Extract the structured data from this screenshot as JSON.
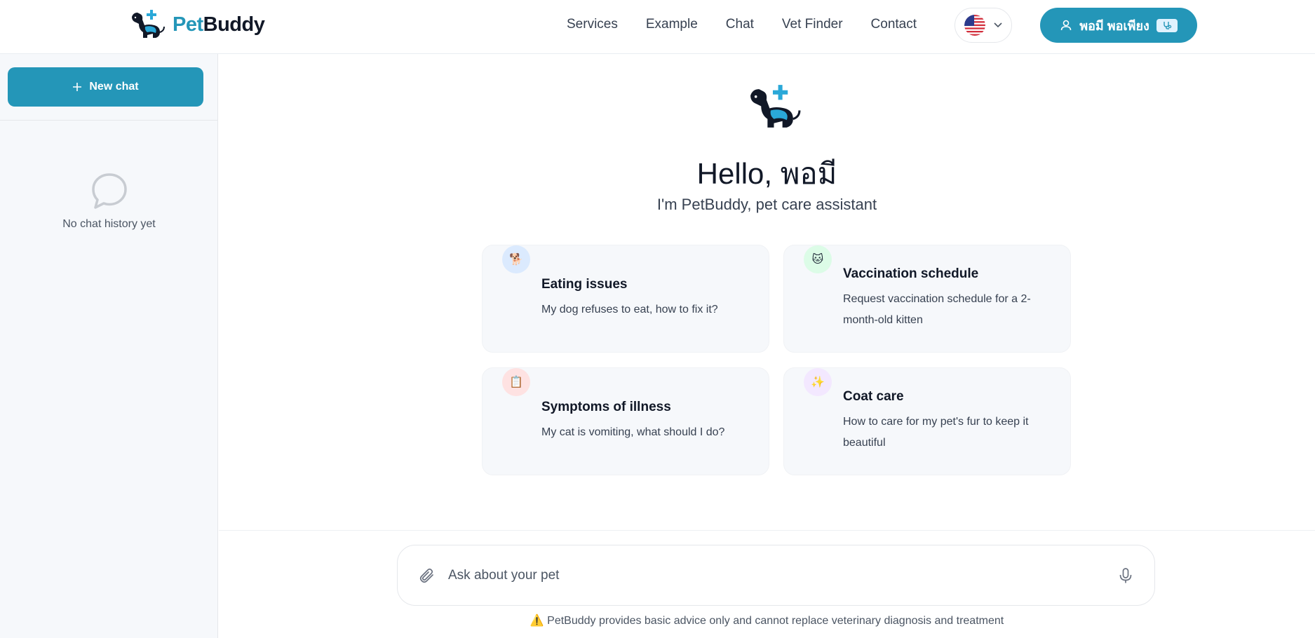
{
  "brand": {
    "name_part1": "Pet",
    "name_part2": "Buddy"
  },
  "nav": {
    "items": [
      "Services",
      "Example",
      "Chat",
      "Vet Finder",
      "Contact"
    ]
  },
  "language": {
    "icon": "us-flag-icon"
  },
  "user": {
    "name": "พอมี พอเพียง"
  },
  "sidebar": {
    "new_chat_label": "New chat",
    "empty_text": "No chat history yet"
  },
  "main": {
    "greeting": "Hello, พอมี",
    "subtitle": "I'm PetBuddy, pet care assistant",
    "suggestions": [
      {
        "icon": "dog-emoji-icon",
        "title": "Eating issues",
        "description": "My dog refuses to eat, how to fix it?"
      },
      {
        "icon": "cat-emoji-icon",
        "title": "Vaccination schedule",
        "description": "Request vaccination schedule for a 2-month-old kitten"
      },
      {
        "icon": "clipboard-emoji-icon",
        "title": "Symptoms of illness",
        "description": "My cat is vomiting, what should I do?"
      },
      {
        "icon": "sparkles-emoji-icon",
        "title": "Coat care",
        "description": "How to care for my pet's fur to keep it beautiful"
      }
    ]
  },
  "composer": {
    "placeholder": "Ask about your pet"
  },
  "disclaimer": {
    "icon": "⚠️",
    "text": "PetBuddy provides basic advice only and cannot replace veterinary diagnosis and treatment"
  },
  "colors": {
    "primary": "#2496b8",
    "sidebar_bg": "#f6f8fb",
    "card_bg": "#f6f8fb"
  }
}
